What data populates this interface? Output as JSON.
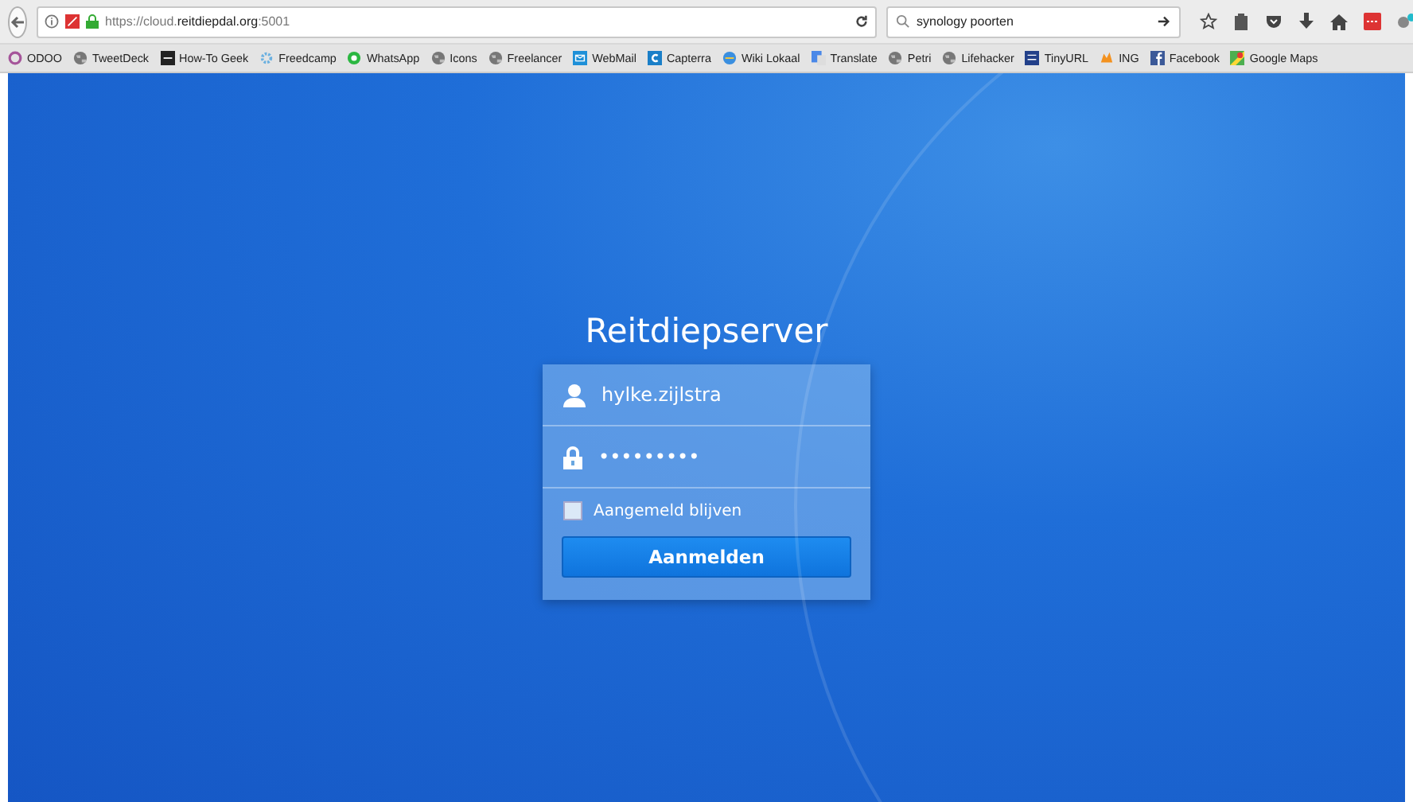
{
  "browser": {
    "url_host_prefix": "https://cloud.",
    "url_host": "reitdiepdal.org",
    "url_port": ":5001",
    "search_value": "synology poorten"
  },
  "bookmarks": [
    {
      "label": "ODOO",
      "kind": "ring"
    },
    {
      "label": "TweetDeck",
      "kind": "globe"
    },
    {
      "label": "How-To Geek",
      "kind": "htg"
    },
    {
      "label": "Freedcamp",
      "kind": "gear"
    },
    {
      "label": "WhatsApp",
      "kind": "chat"
    },
    {
      "label": "Icons",
      "kind": "globe"
    },
    {
      "label": "Freelancer",
      "kind": "globe"
    },
    {
      "label": "WebMail",
      "kind": "mail"
    },
    {
      "label": "Capterra",
      "kind": "letter"
    },
    {
      "label": "Wiki Lokaal",
      "kind": "wiki"
    },
    {
      "label": "Translate",
      "kind": "translate"
    },
    {
      "label": "Petri",
      "kind": "globe"
    },
    {
      "label": "Lifehacker",
      "kind": "globe"
    },
    {
      "label": "TinyURL",
      "kind": "tiny"
    },
    {
      "label": "ING",
      "kind": "lion"
    },
    {
      "label": "Facebook",
      "kind": "fb"
    },
    {
      "label": "Google Maps",
      "kind": "maps"
    }
  ],
  "login": {
    "title": "Reitdiepserver",
    "username": "hylke.zijlstra",
    "password": "•••••••••",
    "remember_label": "Aangemeld blijven",
    "remember_checked": false,
    "submit": "Aanmelden"
  }
}
